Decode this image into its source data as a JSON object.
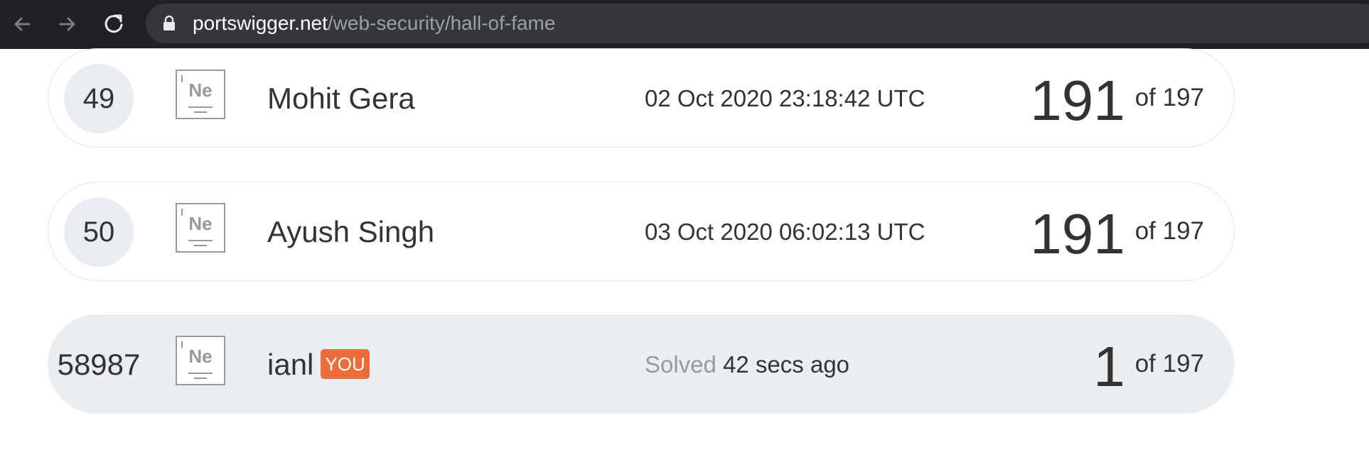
{
  "browser": {
    "url_host": "portswigger.net",
    "url_path": "/web-security/hall-of-fame"
  },
  "leaderboard": [
    {
      "rank": "49",
      "element": "Ne",
      "name": "Mohit Gera",
      "date": "02 Oct 2020 23:18:42 UTC",
      "score": "191",
      "of": "of 197"
    },
    {
      "rank": "50",
      "element": "Ne",
      "name": "Ayush Singh",
      "date": "03 Oct 2020 06:02:13 UTC",
      "score": "191",
      "of": "of 197"
    }
  ],
  "you": {
    "rank": "58987",
    "element": "Ne",
    "name": "ianl",
    "badge": "YOU",
    "solved_prefix": "Solved",
    "solved_time": "42 secs ago",
    "score": "1",
    "of": "of 197"
  }
}
